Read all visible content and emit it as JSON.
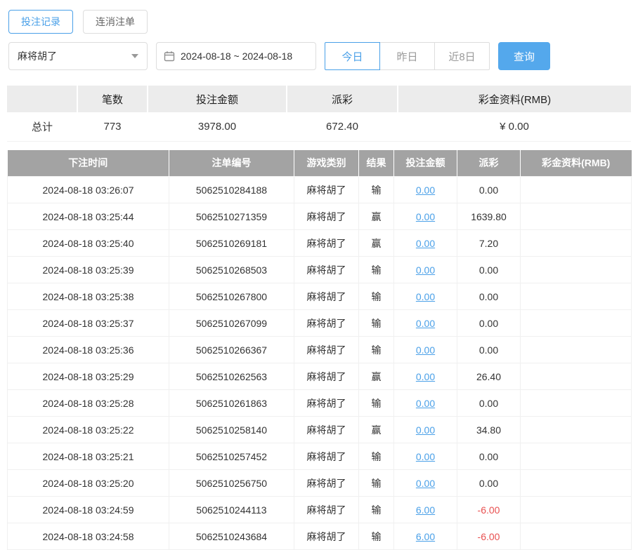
{
  "accent_color": "#4aa0e8",
  "negative_color": "#e85050",
  "tabs": [
    {
      "label": "投注记录",
      "active": true
    },
    {
      "label": "连消注单",
      "active": false
    }
  ],
  "filters": {
    "game_select": {
      "value": "麻将胡了"
    },
    "date_range": "2024-08-18 ~ 2024-08-18",
    "quick_buttons": [
      {
        "label": "今日",
        "active": true
      },
      {
        "label": "昨日",
        "active": false
      },
      {
        "label": "近8日",
        "active": false
      }
    ],
    "search_label": "查询"
  },
  "summary": {
    "headers": [
      "",
      "笔数",
      "投注金额",
      "派彩",
      "彩金资料(RMB)"
    ],
    "row": {
      "label": "总计",
      "count": "773",
      "bet_amount": "3978.00",
      "payout": "672.40",
      "bonus": "¥ 0.00"
    }
  },
  "table": {
    "headers": [
      "下注时间",
      "注单编号",
      "游戏类别",
      "结果",
      "投注金额",
      "派彩",
      "彩金资料(RMB)"
    ],
    "rows": [
      {
        "time": "2024-08-18 03:26:07",
        "order_id": "5062510284188",
        "game": "麻将胡了",
        "result": "输",
        "bet": "0.00",
        "payout": "0.00",
        "bonus": ""
      },
      {
        "time": "2024-08-18 03:25:44",
        "order_id": "5062510271359",
        "game": "麻将胡了",
        "result": "赢",
        "bet": "0.00",
        "payout": "1639.80",
        "bonus": ""
      },
      {
        "time": "2024-08-18 03:25:40",
        "order_id": "5062510269181",
        "game": "麻将胡了",
        "result": "赢",
        "bet": "0.00",
        "payout": "7.20",
        "bonus": ""
      },
      {
        "time": "2024-08-18 03:25:39",
        "order_id": "5062510268503",
        "game": "麻将胡了",
        "result": "输",
        "bet": "0.00",
        "payout": "0.00",
        "bonus": ""
      },
      {
        "time": "2024-08-18 03:25:38",
        "order_id": "5062510267800",
        "game": "麻将胡了",
        "result": "输",
        "bet": "0.00",
        "payout": "0.00",
        "bonus": ""
      },
      {
        "time": "2024-08-18 03:25:37",
        "order_id": "5062510267099",
        "game": "麻将胡了",
        "result": "输",
        "bet": "0.00",
        "payout": "0.00",
        "bonus": ""
      },
      {
        "time": "2024-08-18 03:25:36",
        "order_id": "5062510266367",
        "game": "麻将胡了",
        "result": "输",
        "bet": "0.00",
        "payout": "0.00",
        "bonus": ""
      },
      {
        "time": "2024-08-18 03:25:29",
        "order_id": "5062510262563",
        "game": "麻将胡了",
        "result": "赢",
        "bet": "0.00",
        "payout": "26.40",
        "bonus": ""
      },
      {
        "time": "2024-08-18 03:25:28",
        "order_id": "5062510261863",
        "game": "麻将胡了",
        "result": "输",
        "bet": "0.00",
        "payout": "0.00",
        "bonus": ""
      },
      {
        "time": "2024-08-18 03:25:22",
        "order_id": "5062510258140",
        "game": "麻将胡了",
        "result": "赢",
        "bet": "0.00",
        "payout": "34.80",
        "bonus": ""
      },
      {
        "time": "2024-08-18 03:25:21",
        "order_id": "5062510257452",
        "game": "麻将胡了",
        "result": "输",
        "bet": "0.00",
        "payout": "0.00",
        "bonus": ""
      },
      {
        "time": "2024-08-18 03:25:20",
        "order_id": "5062510256750",
        "game": "麻将胡了",
        "result": "输",
        "bet": "0.00",
        "payout": "0.00",
        "bonus": ""
      },
      {
        "time": "2024-08-18 03:24:59",
        "order_id": "5062510244113",
        "game": "麻将胡了",
        "result": "输",
        "bet": "6.00",
        "payout": "-6.00",
        "bonus": ""
      },
      {
        "time": "2024-08-18 03:24:58",
        "order_id": "5062510243684",
        "game": "麻将胡了",
        "result": "输",
        "bet": "6.00",
        "payout": "-6.00",
        "bonus": ""
      }
    ]
  }
}
